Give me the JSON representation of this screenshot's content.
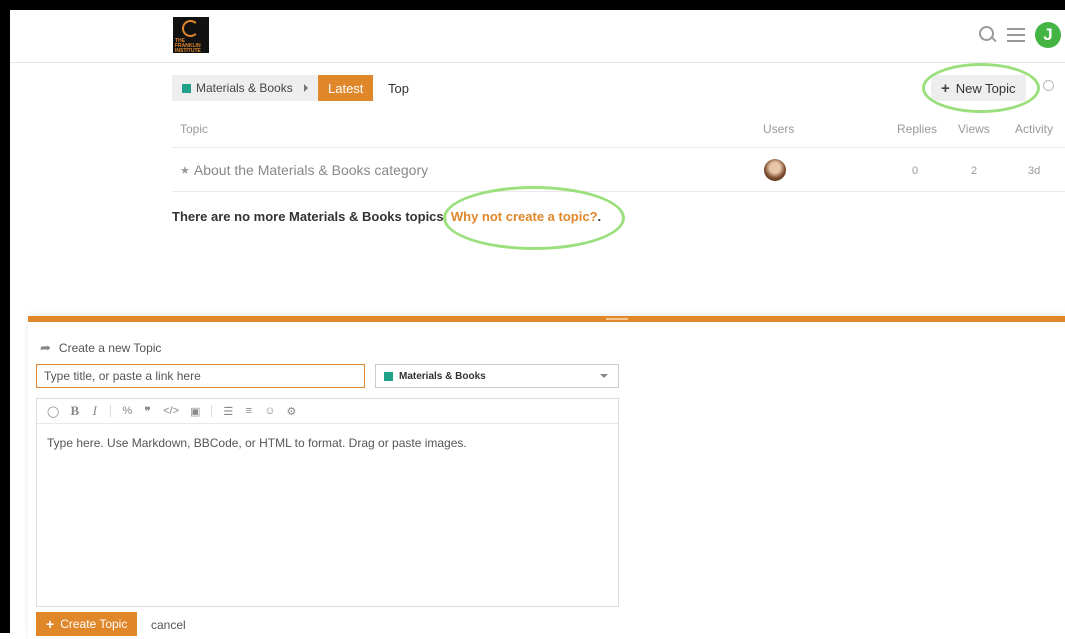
{
  "header": {
    "logo_text": "THE FRANKLIN INSTITUTE",
    "avatar_letter": "J"
  },
  "nav": {
    "category": "Materials & Books",
    "tab_latest": "Latest",
    "tab_top": "Top",
    "new_topic": "New Topic"
  },
  "table": {
    "headers": {
      "topic": "Topic",
      "users": "Users",
      "replies": "Replies",
      "views": "Views",
      "activity": "Activity"
    },
    "rows": [
      {
        "title": "About the Materials & Books category",
        "replies": "0",
        "views": "2",
        "activity": "3d"
      }
    ]
  },
  "empty_state": {
    "text": "There are no more Materials & Books topics.",
    "link": "Why not create a topic?",
    "suffix": "."
  },
  "composer": {
    "heading": "Create a new Topic",
    "title_placeholder": "Type title, or paste a link here",
    "category": "Materials & Books",
    "editor_placeholder": "Type here. Use Markdown, BBCode, or HTML to format. Drag or paste images.",
    "create_button": "Create Topic",
    "cancel": "cancel"
  },
  "colors": {
    "accent": "#e0872a",
    "category": "#20a28a",
    "avatar": "#44b544",
    "highlight": "#9be07d"
  }
}
